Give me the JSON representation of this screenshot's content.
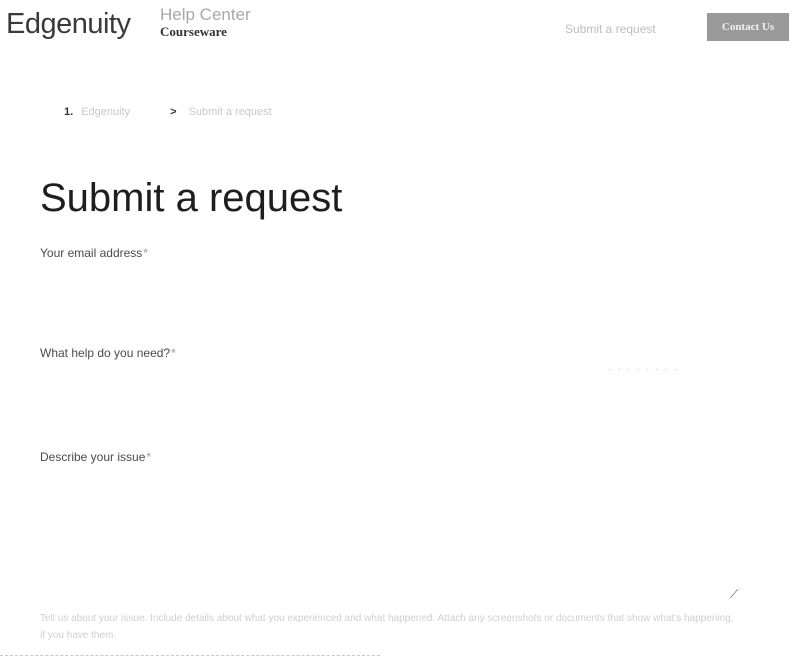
{
  "header": {
    "logo": "Edgenuity",
    "help_center": "Help Center",
    "sub_brand": "Courseware",
    "submit_link": "Submit a request",
    "contact_button": "Contact Us"
  },
  "breadcrumb": {
    "number": "1.",
    "home": "Edgenuity",
    "separator": ">",
    "current": "Submit a request"
  },
  "page": {
    "title": "Submit a request"
  },
  "form": {
    "email_label": "Your email address",
    "help_label": "What help do you need?",
    "describe_label": "Describe your issue",
    "required_mark": "*",
    "help_text": "Tell us about your issue. Include details about what you experienced and what happened. Attach any screenshots or documents that show what's happening, if you have them."
  }
}
